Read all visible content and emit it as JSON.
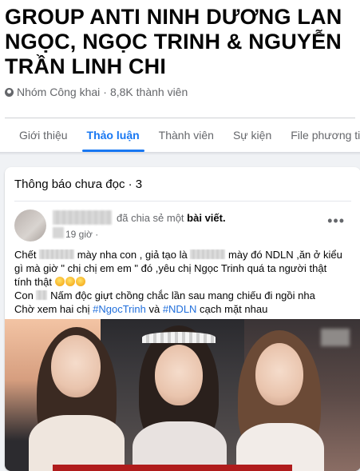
{
  "group": {
    "title": "GROUP ANTI NINH DƯƠNG LAN\nNGỌC, NGỌC TRINH & NGUYỄN\nTRẦN LINH CHI",
    "privacy": "Nhóm Công khai",
    "separator": "·",
    "members": "8,8K thành viên"
  },
  "tabs": [
    {
      "label": "Giới thiệu",
      "active": false
    },
    {
      "label": "Thảo luận",
      "active": true
    },
    {
      "label": "Thành viên",
      "active": false
    },
    {
      "label": "Sự kiện",
      "active": false
    },
    {
      "label": "File phương ti",
      "active": false
    }
  ],
  "feed": {
    "unread_label": "Thông báo chưa đọc · 3"
  },
  "post": {
    "shared_text": "đã chia sẻ một",
    "shared_object": "bài viết.",
    "time": "19 giờ ·",
    "more_icon": "more-dots-icon",
    "line1_a": "Chết ",
    "line1_b": " mày nha con , giả tạo là ",
    "line1_c": " mày đó NDLN ,ăn ở kiểu",
    "line2": "gì mà giờ \" chị chị em em \" đó ,yêu chị Ngọc Trinh quá ta người thật",
    "line3": "tính thật ",
    "line4_a": "Con ",
    "line4_b": " Nấm độc giựt chồng chắc lần sau mang chiếu đi ngồi nha",
    "line5_a": "Chờ xem hai chị ",
    "hashtag1": "#NgocTrinh",
    "line5_b": " và ",
    "hashtag2": "#NDLN",
    "line5_c": " cạch mặt nhau"
  },
  "colors": {
    "accent": "#1877f2",
    "hashtag": "#216fdb",
    "secondary_text": "#65676b"
  }
}
